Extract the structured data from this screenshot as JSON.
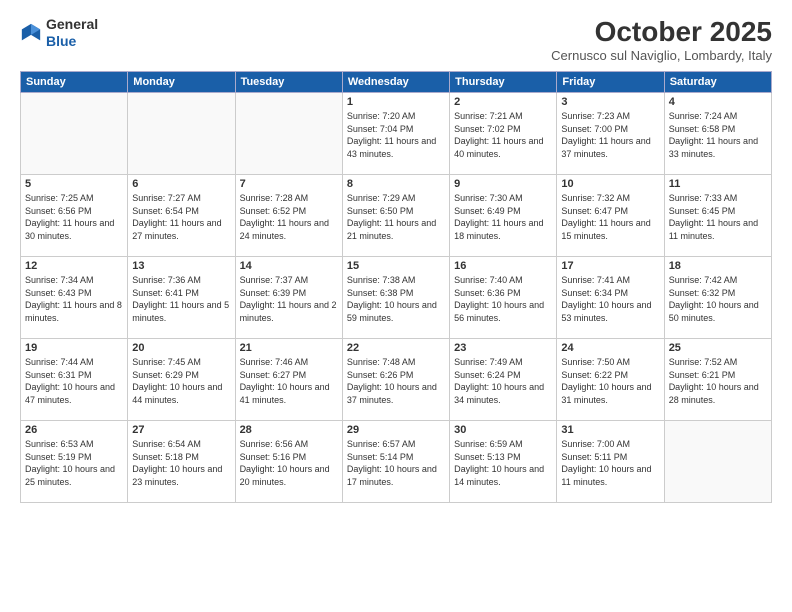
{
  "header": {
    "logo_general": "General",
    "logo_blue": "Blue",
    "month_title": "October 2025",
    "subtitle": "Cernusco sul Naviglio, Lombardy, Italy"
  },
  "weekdays": [
    "Sunday",
    "Monday",
    "Tuesday",
    "Wednesday",
    "Thursday",
    "Friday",
    "Saturday"
  ],
  "weeks": [
    [
      {
        "day": "",
        "info": ""
      },
      {
        "day": "",
        "info": ""
      },
      {
        "day": "",
        "info": ""
      },
      {
        "day": "1",
        "info": "Sunrise: 7:20 AM\nSunset: 7:04 PM\nDaylight: 11 hours\nand 43 minutes."
      },
      {
        "day": "2",
        "info": "Sunrise: 7:21 AM\nSunset: 7:02 PM\nDaylight: 11 hours\nand 40 minutes."
      },
      {
        "day": "3",
        "info": "Sunrise: 7:23 AM\nSunset: 7:00 PM\nDaylight: 11 hours\nand 37 minutes."
      },
      {
        "day": "4",
        "info": "Sunrise: 7:24 AM\nSunset: 6:58 PM\nDaylight: 11 hours\nand 33 minutes."
      }
    ],
    [
      {
        "day": "5",
        "info": "Sunrise: 7:25 AM\nSunset: 6:56 PM\nDaylight: 11 hours\nand 30 minutes."
      },
      {
        "day": "6",
        "info": "Sunrise: 7:27 AM\nSunset: 6:54 PM\nDaylight: 11 hours\nand 27 minutes."
      },
      {
        "day": "7",
        "info": "Sunrise: 7:28 AM\nSunset: 6:52 PM\nDaylight: 11 hours\nand 24 minutes."
      },
      {
        "day": "8",
        "info": "Sunrise: 7:29 AM\nSunset: 6:50 PM\nDaylight: 11 hours\nand 21 minutes."
      },
      {
        "day": "9",
        "info": "Sunrise: 7:30 AM\nSunset: 6:49 PM\nDaylight: 11 hours\nand 18 minutes."
      },
      {
        "day": "10",
        "info": "Sunrise: 7:32 AM\nSunset: 6:47 PM\nDaylight: 11 hours\nand 15 minutes."
      },
      {
        "day": "11",
        "info": "Sunrise: 7:33 AM\nSunset: 6:45 PM\nDaylight: 11 hours\nand 11 minutes."
      }
    ],
    [
      {
        "day": "12",
        "info": "Sunrise: 7:34 AM\nSunset: 6:43 PM\nDaylight: 11 hours\nand 8 minutes."
      },
      {
        "day": "13",
        "info": "Sunrise: 7:36 AM\nSunset: 6:41 PM\nDaylight: 11 hours\nand 5 minutes."
      },
      {
        "day": "14",
        "info": "Sunrise: 7:37 AM\nSunset: 6:39 PM\nDaylight: 11 hours\nand 2 minutes."
      },
      {
        "day": "15",
        "info": "Sunrise: 7:38 AM\nSunset: 6:38 PM\nDaylight: 10 hours\nand 59 minutes."
      },
      {
        "day": "16",
        "info": "Sunrise: 7:40 AM\nSunset: 6:36 PM\nDaylight: 10 hours\nand 56 minutes."
      },
      {
        "day": "17",
        "info": "Sunrise: 7:41 AM\nSunset: 6:34 PM\nDaylight: 10 hours\nand 53 minutes."
      },
      {
        "day": "18",
        "info": "Sunrise: 7:42 AM\nSunset: 6:32 PM\nDaylight: 10 hours\nand 50 minutes."
      }
    ],
    [
      {
        "day": "19",
        "info": "Sunrise: 7:44 AM\nSunset: 6:31 PM\nDaylight: 10 hours\nand 47 minutes."
      },
      {
        "day": "20",
        "info": "Sunrise: 7:45 AM\nSunset: 6:29 PM\nDaylight: 10 hours\nand 44 minutes."
      },
      {
        "day": "21",
        "info": "Sunrise: 7:46 AM\nSunset: 6:27 PM\nDaylight: 10 hours\nand 41 minutes."
      },
      {
        "day": "22",
        "info": "Sunrise: 7:48 AM\nSunset: 6:26 PM\nDaylight: 10 hours\nand 37 minutes."
      },
      {
        "day": "23",
        "info": "Sunrise: 7:49 AM\nSunset: 6:24 PM\nDaylight: 10 hours\nand 34 minutes."
      },
      {
        "day": "24",
        "info": "Sunrise: 7:50 AM\nSunset: 6:22 PM\nDaylight: 10 hours\nand 31 minutes."
      },
      {
        "day": "25",
        "info": "Sunrise: 7:52 AM\nSunset: 6:21 PM\nDaylight: 10 hours\nand 28 minutes."
      }
    ],
    [
      {
        "day": "26",
        "info": "Sunrise: 6:53 AM\nSunset: 5:19 PM\nDaylight: 10 hours\nand 25 minutes."
      },
      {
        "day": "27",
        "info": "Sunrise: 6:54 AM\nSunset: 5:18 PM\nDaylight: 10 hours\nand 23 minutes."
      },
      {
        "day": "28",
        "info": "Sunrise: 6:56 AM\nSunset: 5:16 PM\nDaylight: 10 hours\nand 20 minutes."
      },
      {
        "day": "29",
        "info": "Sunrise: 6:57 AM\nSunset: 5:14 PM\nDaylight: 10 hours\nand 17 minutes."
      },
      {
        "day": "30",
        "info": "Sunrise: 6:59 AM\nSunset: 5:13 PM\nDaylight: 10 hours\nand 14 minutes."
      },
      {
        "day": "31",
        "info": "Sunrise: 7:00 AM\nSunset: 5:11 PM\nDaylight: 10 hours\nand 11 minutes."
      },
      {
        "day": "",
        "info": ""
      }
    ]
  ]
}
